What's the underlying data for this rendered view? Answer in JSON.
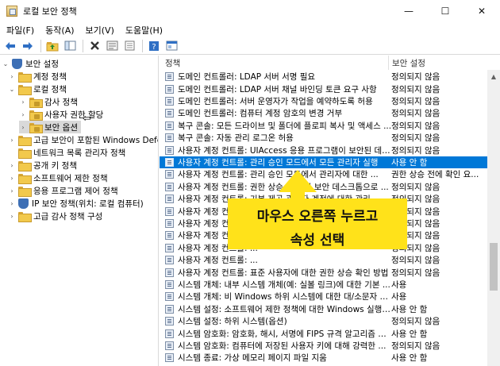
{
  "window": {
    "title": "로컬 보안 정책",
    "minimize": "—",
    "maximize": "☐",
    "close": "✕"
  },
  "menu": [
    "파일(F)",
    "동작(A)",
    "보기(V)",
    "도움말(H)"
  ],
  "toolbar": {
    "icons": [
      "back-icon",
      "forward-icon",
      "up-folder-icon",
      "show-hide-tree-icon",
      "delete-icon",
      "properties-icon",
      "export-list-icon",
      "help-icon",
      "console-icon"
    ]
  },
  "tree": [
    {
      "label": "보안 설정",
      "level": 0,
      "expander": "⌄",
      "icon": "shield-icon"
    },
    {
      "label": "계정 정책",
      "level": 1,
      "expander": "›",
      "icon": "folder-icon"
    },
    {
      "label": "로컬 정책",
      "level": 1,
      "expander": "⌄",
      "icon": "folder-icon"
    },
    {
      "label": "감사 정책",
      "level": 2,
      "expander": "›",
      "icon": "folder-lock-icon"
    },
    {
      "label": "사용자 권한 할당",
      "level": 2,
      "expander": "›",
      "icon": "folder-lock-icon"
    },
    {
      "label": "보안 옵션",
      "level": 2,
      "expander": "›",
      "icon": "folder-lock-icon",
      "selected": true
    },
    {
      "label": "고급 보안이 포함된 Windows Defenc",
      "level": 1,
      "expander": "›",
      "icon": "folder-icon"
    },
    {
      "label": "네트워크 목록 관리자 정책",
      "level": 1,
      "expander": "",
      "icon": "folder-icon"
    },
    {
      "label": "공개 키 정책",
      "level": 1,
      "expander": "›",
      "icon": "folder-icon"
    },
    {
      "label": "소프트웨어 제한 정책",
      "level": 1,
      "expander": "›",
      "icon": "folder-icon"
    },
    {
      "label": "응용 프로그램 제어 정책",
      "level": 1,
      "expander": "›",
      "icon": "folder-icon"
    },
    {
      "label": "IP 보안 정책(위치: 로컬 컴퓨터)",
      "level": 1,
      "expander": "›",
      "icon": "shield-icon"
    },
    {
      "label": "고급 감사 정책 구성",
      "level": 1,
      "expander": "›",
      "icon": "folder-icon"
    }
  ],
  "annotation_arrow": "⇦",
  "columns": {
    "policy": "정책",
    "setting": "보안 설정"
  },
  "rows": [
    {
      "policy": "도메인 컨트롤러: LDAP 서버 서명 필요",
      "setting": "정의되지 않음"
    },
    {
      "policy": "도메인 컨트롤러: LDAP 서버 채널 바인딩 토큰 요구 사항",
      "setting": "정의되지 않음"
    },
    {
      "policy": "도메인 컨트롤러: 서버 운영자가 작업을 예약하도록 허용",
      "setting": "정의되지 않음"
    },
    {
      "policy": "도메인 컨트롤러: 컴퓨터 계정 암호의 변경 거부",
      "setting": "정의되지 않음"
    },
    {
      "policy": "복구 콘솔: 모든 드라이브 및 폴더에 플로피 복사 및 액세스 ...",
      "setting": "정의되지 않음"
    },
    {
      "policy": "복구 콘솔: 자동 관리 로그온 허용",
      "setting": "정의되지 않음"
    },
    {
      "policy": "사용자 계정 컨트롤: UIAccess 응용 프로그램이 보안된 데스...",
      "setting": "정의되지 않음"
    },
    {
      "policy": "사용자 계정 컨트롤: 관리 승인 모드에서 모든 관리자 실행",
      "setting": "사용 안 함",
      "selected": true
    },
    {
      "policy": "사용자 계정 컨트롤: 관리 승인 모드에서 관리자에 대한 ...",
      "setting": "권한 상승 전에 확인 요..."
    },
    {
      "policy": "사용자 계정 컨트롤: 권한 상승 요청 시 보안 데스크톱으로 ...",
      "setting": "정의되지 않음"
    },
    {
      "policy": "사용자 계정 컨트롤: 기본 제공 관리자 계정에 대한 관리 ...",
      "setting": "정의되지 않음"
    },
    {
      "policy": "사용자 계정 컨트롤: ...",
      "setting": "정의되지 않음"
    },
    {
      "policy": "사용자 계정 컨트롤: ...",
      "setting": "정의되지 않음"
    },
    {
      "policy": "사용자 계정 컨트롤: ...",
      "setting": "정의되지 않음"
    },
    {
      "policy": "사용자 계정 컨트롤: ...",
      "setting": "정의되지 않음"
    },
    {
      "policy": "사용자 계정 컨트롤: ...",
      "setting": "정의되지 않음"
    },
    {
      "policy": "사용자 계정 컨트롤: 표준 사용자에 대한 권한 상승 확인 방법",
      "setting": "정의되지 않음"
    },
    {
      "policy": "시스템 개체: 내부 시스템 개체(예: 실볼 링크)에 대한 기본 ...",
      "setting": "사용"
    },
    {
      "policy": "시스템 개체: 비 Windows 하위 시스템에 대한 대/소문자 구...",
      "setting": "사용"
    },
    {
      "policy": "시스템 설정: 소프트웨어 제한 정책에 대한 Windows 실행 ...",
      "setting": "사용 안 함"
    },
    {
      "policy": "시스템 설정: 하위 시스템(옵션)",
      "setting": "정의되지 않음"
    },
    {
      "policy": "시스템 암호화: 암호화, 해시, 서명에 FIPS 규격 알고리즘 사용",
      "setting": "사용 안 함"
    },
    {
      "policy": "시스템 암호화: 컴퓨터에 저장된 사용자 키에 대해 강력한 ...",
      "setting": "정의되지 않음"
    },
    {
      "policy": "시스템 종료: 가상 메모리 페이지 파일 지움",
      "setting": "사용 안 함"
    }
  ],
  "callout": {
    "line1": "마우스 오른쪽 누르고",
    "line2": "속성 선택",
    "color": "#ffe21a"
  },
  "selection_color": "#0078d7"
}
